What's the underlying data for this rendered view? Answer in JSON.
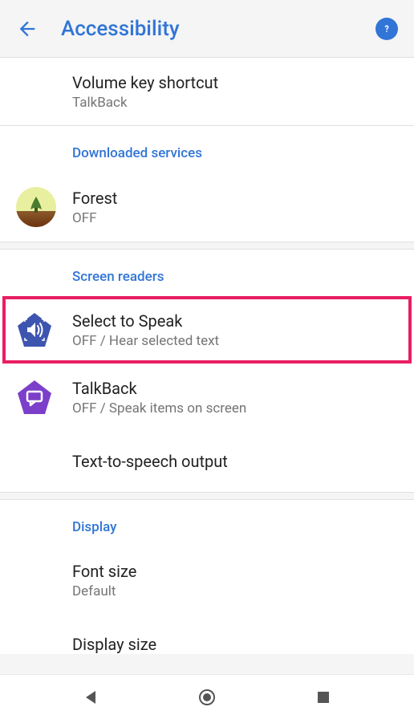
{
  "header": {
    "title": "Accessibility"
  },
  "items": {
    "volume_key": {
      "title": "Volume key shortcut",
      "subtitle": "TalkBack"
    },
    "forest": {
      "title": "Forest",
      "subtitle": "OFF"
    },
    "select_to_speak": {
      "title": "Select to Speak",
      "subtitle": "OFF / Hear selected text"
    },
    "talkback": {
      "title": "TalkBack",
      "subtitle": "OFF / Speak items on screen"
    },
    "tts": {
      "title": "Text-to-speech output"
    },
    "font_size": {
      "title": "Font size",
      "subtitle": "Default"
    },
    "display_size": {
      "title": "Display size"
    }
  },
  "sections": {
    "downloaded": "Downloaded services",
    "screen_readers": "Screen readers",
    "display": "Display"
  }
}
